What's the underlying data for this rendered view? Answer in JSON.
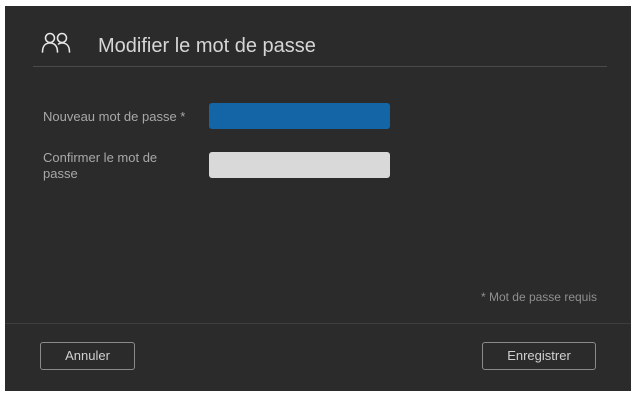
{
  "dialog": {
    "title": "Modifier le mot de passe",
    "icon": "users-icon"
  },
  "form": {
    "new_password_label": "Nouveau mot de passe *",
    "new_password_value": "",
    "confirm_password_label": "Confirmer le mot de passe",
    "confirm_password_value": ""
  },
  "required_note": "* Mot de passe requis",
  "buttons": {
    "cancel_label": "Annuler",
    "save_label": "Enregistrer"
  },
  "colors": {
    "dialog_background": "#2b2b2b",
    "active_input": "#1465a6",
    "inactive_input": "#d9d9d9"
  }
}
